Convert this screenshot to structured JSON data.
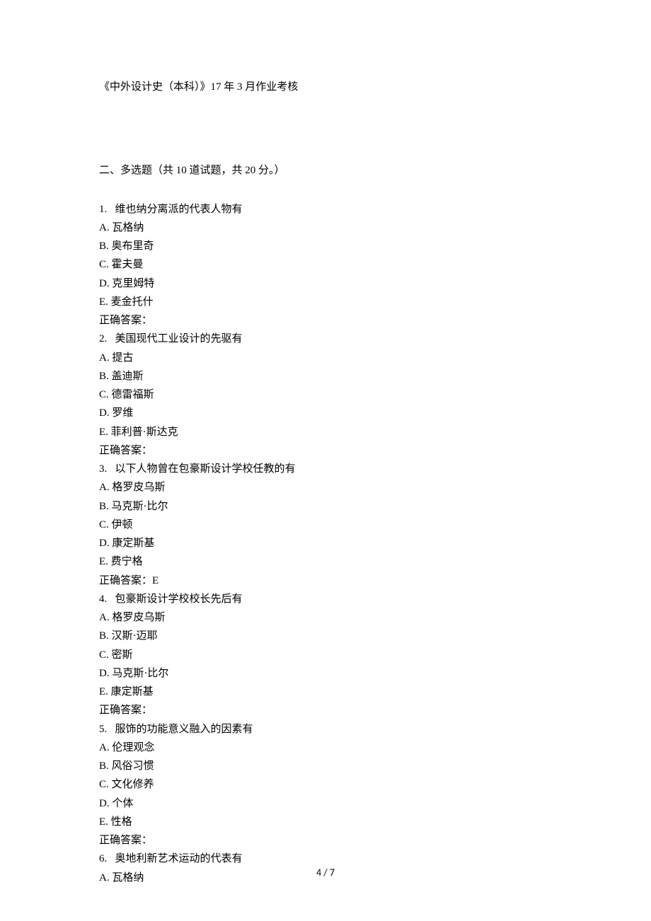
{
  "title": "《中外设计史（本科）》17 年 3 月作业考核",
  "section": "二、多选题（共 10 道试题，共 20 分。）",
  "questions": [
    {
      "num": "1.",
      "text": "维也纳分离派的代表人物有",
      "options": [
        {
          "label": "A.",
          "text": "瓦格纳"
        },
        {
          "label": "B.",
          "text": "奥布里奇"
        },
        {
          "label": "C.",
          "text": "霍夫曼"
        },
        {
          "label": "D.",
          "text": "克里姆特"
        },
        {
          "label": "E.",
          "text": "麦金托什"
        }
      ],
      "answer_label": "正确答案：",
      "answer": ""
    },
    {
      "num": "2.",
      "text": "美国现代工业设计的先驱有",
      "options": [
        {
          "label": "A.",
          "text": "提古"
        },
        {
          "label": "B.",
          "text": "盖迪斯"
        },
        {
          "label": "C.",
          "text": "德雷福斯"
        },
        {
          "label": "D.",
          "text": "罗维"
        },
        {
          "label": "E.",
          "text": "菲利普·斯达克"
        }
      ],
      "answer_label": "正确答案：",
      "answer": ""
    },
    {
      "num": "3.",
      "text": "以下人物曾在包豪斯设计学校任教的有",
      "options": [
        {
          "label": "A.",
          "text": "格罗皮乌斯"
        },
        {
          "label": "B.",
          "text": "马克斯·比尔"
        },
        {
          "label": "C.",
          "text": "伊顿"
        },
        {
          "label": "D.",
          "text": "康定斯基"
        },
        {
          "label": "E.",
          "text": "费宁格"
        }
      ],
      "answer_label": "正确答案：",
      "answer": "E"
    },
    {
      "num": "4.",
      "text": "包豪斯设计学校校长先后有",
      "options": [
        {
          "label": "A.",
          "text": "格罗皮乌斯"
        },
        {
          "label": "B.",
          "text": "汉斯·迈耶"
        },
        {
          "label": "C.",
          "text": "密斯"
        },
        {
          "label": "D.",
          "text": "马克斯·比尔"
        },
        {
          "label": "E.",
          "text": "康定斯基"
        }
      ],
      "answer_label": "正确答案：",
      "answer": ""
    },
    {
      "num": "5.",
      "text": "服饰的功能意义融入的因素有",
      "options": [
        {
          "label": "A.",
          "text": "伦理观念"
        },
        {
          "label": "B.",
          "text": "风俗习惯"
        },
        {
          "label": "C.",
          "text": "文化修养"
        },
        {
          "label": "D.",
          "text": "个体"
        },
        {
          "label": "E.",
          "text": "性格"
        }
      ],
      "answer_label": "正确答案：",
      "answer": ""
    },
    {
      "num": "6.",
      "text": "奥地利新艺术运动的代表有",
      "options": [
        {
          "label": "A.",
          "text": "瓦格纳"
        }
      ],
      "answer_label": "",
      "answer": ""
    }
  ],
  "page_number": "4 / 7"
}
